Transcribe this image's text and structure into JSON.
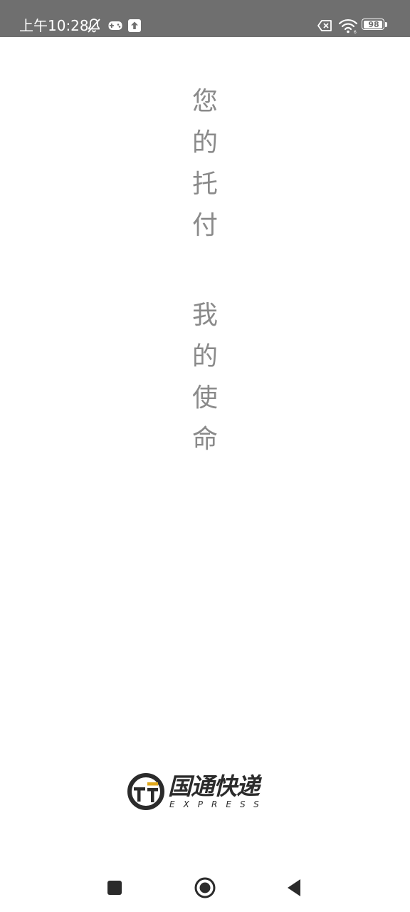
{
  "status_bar": {
    "time": "上午10:28",
    "battery": "98",
    "battery_fraction": 0.98,
    "icons": [
      "mute-bell-icon",
      "gamepad-icon",
      "upload-icon",
      "sim-error-icon",
      "wifi-icon",
      "battery-icon"
    ]
  },
  "slogan": {
    "line1": [
      "您",
      "的",
      "托",
      "付"
    ],
    "line2": [
      "我",
      "的",
      "使",
      "命"
    ]
  },
  "logo": {
    "name": "国通快递",
    "subtitle": "EXPRESS",
    "accent_color": "#e0a81c",
    "text_color": "#2b2b2b"
  },
  "nav_bar": {
    "buttons": [
      "recents-button",
      "home-button",
      "back-button"
    ]
  },
  "colors": {
    "status_bar_bg": "#6f6f6f",
    "slogan_text": "#8a8a8a",
    "background": "#ffffff"
  }
}
